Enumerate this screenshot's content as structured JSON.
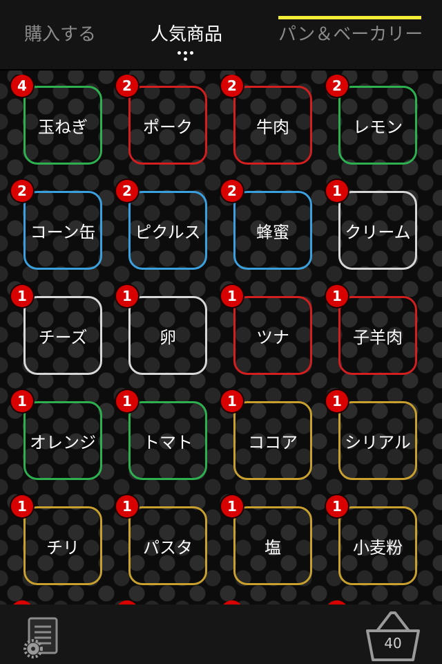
{
  "tabs": {
    "left": "購入する",
    "center": "人気商品",
    "right": "パン＆ベーカリー"
  },
  "colors": {
    "green": "#2db150",
    "red": "#d31f1f",
    "blue": "#3aa0de",
    "white": "#d8d8d8",
    "gold": "#c7a02e",
    "badge": "#d90000",
    "indicator": "#f2ee37"
  },
  "items": [
    {
      "label": "玉ねぎ",
      "count": "4",
      "color": "green"
    },
    {
      "label": "ポーク",
      "count": "2",
      "color": "red"
    },
    {
      "label": "牛肉",
      "count": "2",
      "color": "red"
    },
    {
      "label": "レモン",
      "count": "2",
      "color": "green"
    },
    {
      "label": "コーン缶",
      "count": "2",
      "color": "blue"
    },
    {
      "label": "ピクルス",
      "count": "2",
      "color": "blue"
    },
    {
      "label": "蜂蜜",
      "count": "2",
      "color": "blue"
    },
    {
      "label": "クリーム",
      "count": "1",
      "color": "white"
    },
    {
      "label": "チーズ",
      "count": "1",
      "color": "white"
    },
    {
      "label": "卵",
      "count": "1",
      "color": "white"
    },
    {
      "label": "ツナ",
      "count": "1",
      "color": "red"
    },
    {
      "label": "子羊肉",
      "count": "1",
      "color": "red"
    },
    {
      "label": "オレンジ",
      "count": "1",
      "color": "green"
    },
    {
      "label": "トマト",
      "count": "1",
      "color": "green"
    },
    {
      "label": "ココア",
      "count": "1",
      "color": "gold"
    },
    {
      "label": "シリアル",
      "count": "1",
      "color": "gold"
    },
    {
      "label": "チリ",
      "count": "1",
      "color": "gold"
    },
    {
      "label": "パスタ",
      "count": "1",
      "color": "gold"
    },
    {
      "label": "塩",
      "count": "1",
      "color": "gold"
    },
    {
      "label": "小麦粉",
      "count": "1",
      "color": "gold"
    }
  ],
  "footer": {
    "settings_icon": "list-gear-icon",
    "basket_icon": "basket-icon",
    "basket_count": "40"
  }
}
